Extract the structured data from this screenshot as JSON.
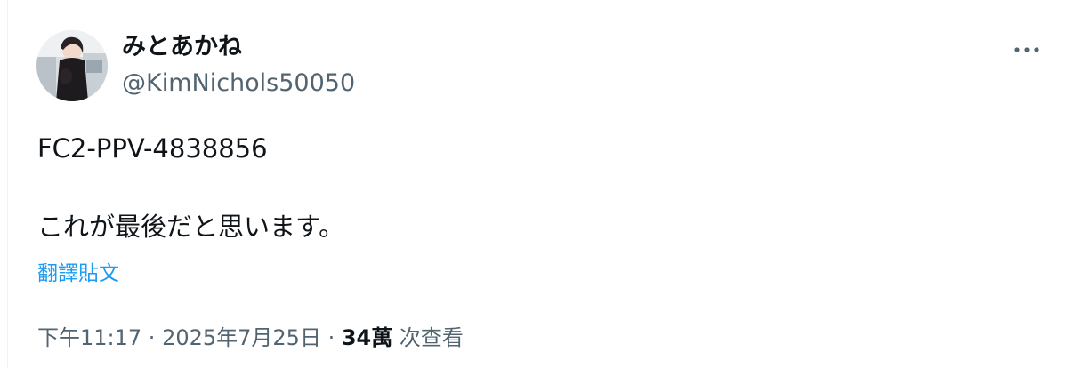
{
  "tweet": {
    "author": {
      "display_name": "みとあかね",
      "handle": "@KimNichols50050",
      "avatar_icon": "profile-photo"
    },
    "more_icon": "more-horizontal-icon",
    "text_lines": [
      "FC2-PPV-4838856",
      "",
      "これが最後だと思います。"
    ],
    "translate_label": "翻譯貼文",
    "meta": {
      "time": "下午11:17",
      "separator": " · ",
      "date": "2025年7月25日",
      "views_count": "34萬",
      "views_label": " 次查看"
    },
    "colors": {
      "text": "#0f1419",
      "secondary": "#536471",
      "link": "#1d9bf0",
      "border": "#eff3f4"
    }
  }
}
